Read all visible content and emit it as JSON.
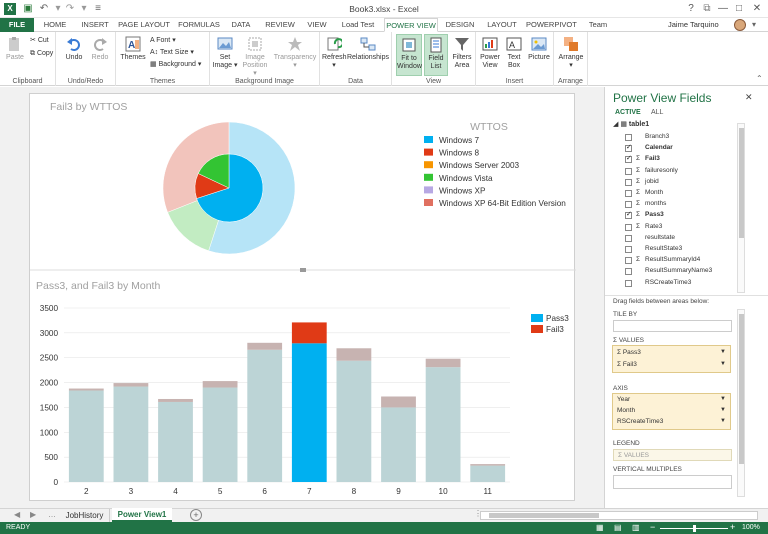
{
  "window": {
    "title": "Book3.xlsx - Excel",
    "help": "?",
    "minimize": "—",
    "restore": "□",
    "close": "✕"
  },
  "tabs": [
    {
      "label": "FILE"
    },
    {
      "label": "HOME"
    },
    {
      "label": "INSERT"
    },
    {
      "label": "PAGE LAYOUT"
    },
    {
      "label": "FORMULAS"
    },
    {
      "label": "DATA"
    },
    {
      "label": "REVIEW"
    },
    {
      "label": "VIEW"
    },
    {
      "label": "Load Test"
    },
    {
      "label": "POWER VIEW"
    },
    {
      "label": "DESIGN"
    },
    {
      "label": "LAYOUT"
    },
    {
      "label": "POWERPIVOT"
    },
    {
      "label": "Team"
    }
  ],
  "user": {
    "name": "Jaime Tarquino"
  },
  "ribbon": {
    "clipboard": {
      "label": "Clipboard",
      "paste": "Paste",
      "cut": "Cut",
      "copy": "Copy"
    },
    "undo_redo": {
      "label": "Undo/Redo",
      "undo": "Undo",
      "redo": "Redo"
    },
    "themes": {
      "label": "Themes",
      "themes_btn": "Themes",
      "font": "Font",
      "text_size": "Text Size",
      "background": "Background"
    },
    "background_image": {
      "label": "Background Image",
      "set_image_1": "Set",
      "set_image_2": "Image",
      "image_position_1": "Image",
      "image_position_2": "Position",
      "transparency": "Transparency"
    },
    "data": {
      "label": "Data",
      "refresh": "Refresh",
      "relationships": "Relationships"
    },
    "view": {
      "label": "View",
      "fit_1": "Fit to",
      "fit_2": "Window",
      "field_1": "Field",
      "field_2": "List",
      "filters_1": "Filters",
      "filters_2": "Area"
    },
    "insert": {
      "label": "Insert",
      "pv_1": "Power",
      "pv_2": "View",
      "tb_1": "Text",
      "tb_2": "Box",
      "picture": "Picture"
    },
    "arrange": {
      "label": "Arrange",
      "arrange_btn": "Arrange"
    }
  },
  "colors": {
    "excel_green": "#217346",
    "windows7": "#00b0f0",
    "windows8": "#e03a16",
    "server2003": "#f79500",
    "vista": "#33c433",
    "xp": "#b7a8e3",
    "xp64": "#e07060",
    "pass3": "#00b0f0",
    "fail3": "#e03a16"
  },
  "pie_chart": {
    "title": "Fail3 by WTTOS",
    "legend_title": "WTTOS",
    "legend": [
      {
        "label": "Windows 7"
      },
      {
        "label": "Windows 8"
      },
      {
        "label": "Windows Server 2003"
      },
      {
        "label": "Windows Vista"
      },
      {
        "label": "Windows XP"
      },
      {
        "label": "Windows XP 64-Bit Edition Version"
      }
    ]
  },
  "chart_data": [
    {
      "type": "pie",
      "title": "Fail3 by WTTOS",
      "categories": [
        "Windows 7",
        "Windows 8",
        "Windows Server 2003",
        "Windows Vista",
        "Windows XP",
        "Windows XP 64-Bit Edition Version"
      ],
      "outer_ring": [
        55,
        0,
        0,
        14,
        0,
        31
      ],
      "inner_ring": [
        70,
        12,
        0,
        18,
        0,
        0
      ]
    },
    {
      "type": "bar",
      "title": "Pass3, and Fail3 by Month",
      "categories": [
        "2",
        "3",
        "4",
        "5",
        "6",
        "7",
        "8",
        "9",
        "10",
        "11"
      ],
      "series": [
        {
          "name": "Pass3",
          "values": [
            1840,
            1920,
            1610,
            1900,
            2660,
            2790,
            2440,
            1500,
            2310,
            330
          ]
        },
        {
          "name": "Fail3",
          "values": [
            40,
            70,
            60,
            130,
            140,
            420,
            250,
            220,
            170,
            30
          ]
        }
      ],
      "highlighted_category": "7",
      "ylim": [
        0,
        3500
      ],
      "yticks": [
        0,
        500,
        1000,
        1500,
        2000,
        2500,
        3000,
        3500
      ],
      "legend_position": "top-right"
    }
  ],
  "fields_panel": {
    "title": "Power View Fields",
    "close": "✕",
    "tab_active": "ACTIVE",
    "tab_all": "ALL",
    "table": "table1",
    "fields": [
      {
        "name": "Branch3",
        "checked": false,
        "sigma": false
      },
      {
        "name": "Calendar",
        "checked": true,
        "sigma": false,
        "bold": true
      },
      {
        "name": "Fail3",
        "checked": true,
        "sigma": true,
        "bold": true
      },
      {
        "name": "failuresonly",
        "checked": false,
        "sigma": true
      },
      {
        "name": "jobid",
        "checked": false,
        "sigma": true
      },
      {
        "name": "Month",
        "checked": false,
        "sigma": true
      },
      {
        "name": "months",
        "checked": false,
        "sigma": true
      },
      {
        "name": "Pass3",
        "checked": true,
        "sigma": true,
        "bold": true
      },
      {
        "name": "Rate3",
        "checked": false,
        "sigma": true
      },
      {
        "name": "resultstate",
        "checked": false,
        "sigma": false
      },
      {
        "name": "ResultState3",
        "checked": false,
        "sigma": false
      },
      {
        "name": "ResultSummaryId4",
        "checked": false,
        "sigma": true
      },
      {
        "name": "ResultSummaryName3",
        "checked": false,
        "sigma": false
      },
      {
        "name": "RSCreateTime3",
        "checked": false,
        "sigma": false
      }
    ],
    "drag_hint": "Drag fields between areas below:",
    "tile_by": "TILE BY",
    "values_label": "VALUES",
    "values": [
      "Pass3",
      "Fail3"
    ],
    "axis_label": "AXIS",
    "axis": [
      "Year",
      "Month",
      "RSCreateTime3"
    ],
    "legend_label": "LEGEND",
    "legend_placeholder": "VALUES",
    "vertical_multiples": "VERTICAL MULTIPLES"
  },
  "sheet_tabs": [
    {
      "label": "JobHistory",
      "active": false
    },
    {
      "label": "Power View1",
      "active": true
    }
  ],
  "status": {
    "ready": "READY",
    "zoom": "100%"
  }
}
